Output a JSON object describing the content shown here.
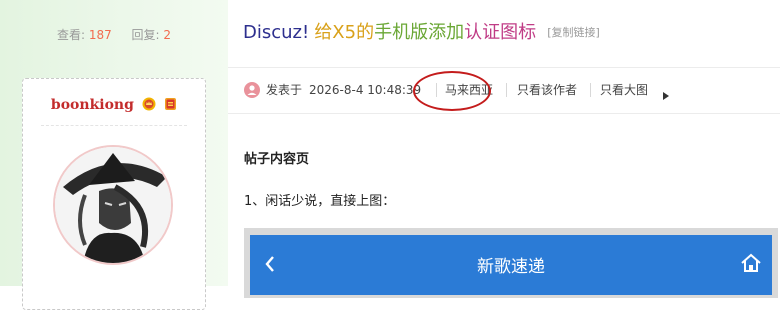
{
  "stats": {
    "views_label": "查看:",
    "views": "187",
    "replies_label": "回复:",
    "replies": "2"
  },
  "user": {
    "name": "boonkiong"
  },
  "thread": {
    "title_parts": [
      "Discuz!",
      "给X5的",
      "手机版添加",
      "认证图标"
    ],
    "copy_link": "[复制链接]"
  },
  "meta": {
    "posted_label": "发表于",
    "posted_time": "2026-8-4 10:48:39",
    "region": "马来西亚",
    "only_author": "只看该作者",
    "view_large": "只看大图"
  },
  "content": {
    "heading": "帖子内容页",
    "line1": "1、闲话少说，直接上图："
  },
  "preview": {
    "title": "新歌速递"
  },
  "colors": {
    "accent_red": "#c41c1c",
    "username": "#c32c2c",
    "preview_bar": "#2b7bd6",
    "stat_num": "#f26c4f"
  },
  "icons": [
    "crown-icon",
    "medal-icon",
    "user-icon",
    "caret-right-icon",
    "back-arrow-icon",
    "home-icon"
  ]
}
